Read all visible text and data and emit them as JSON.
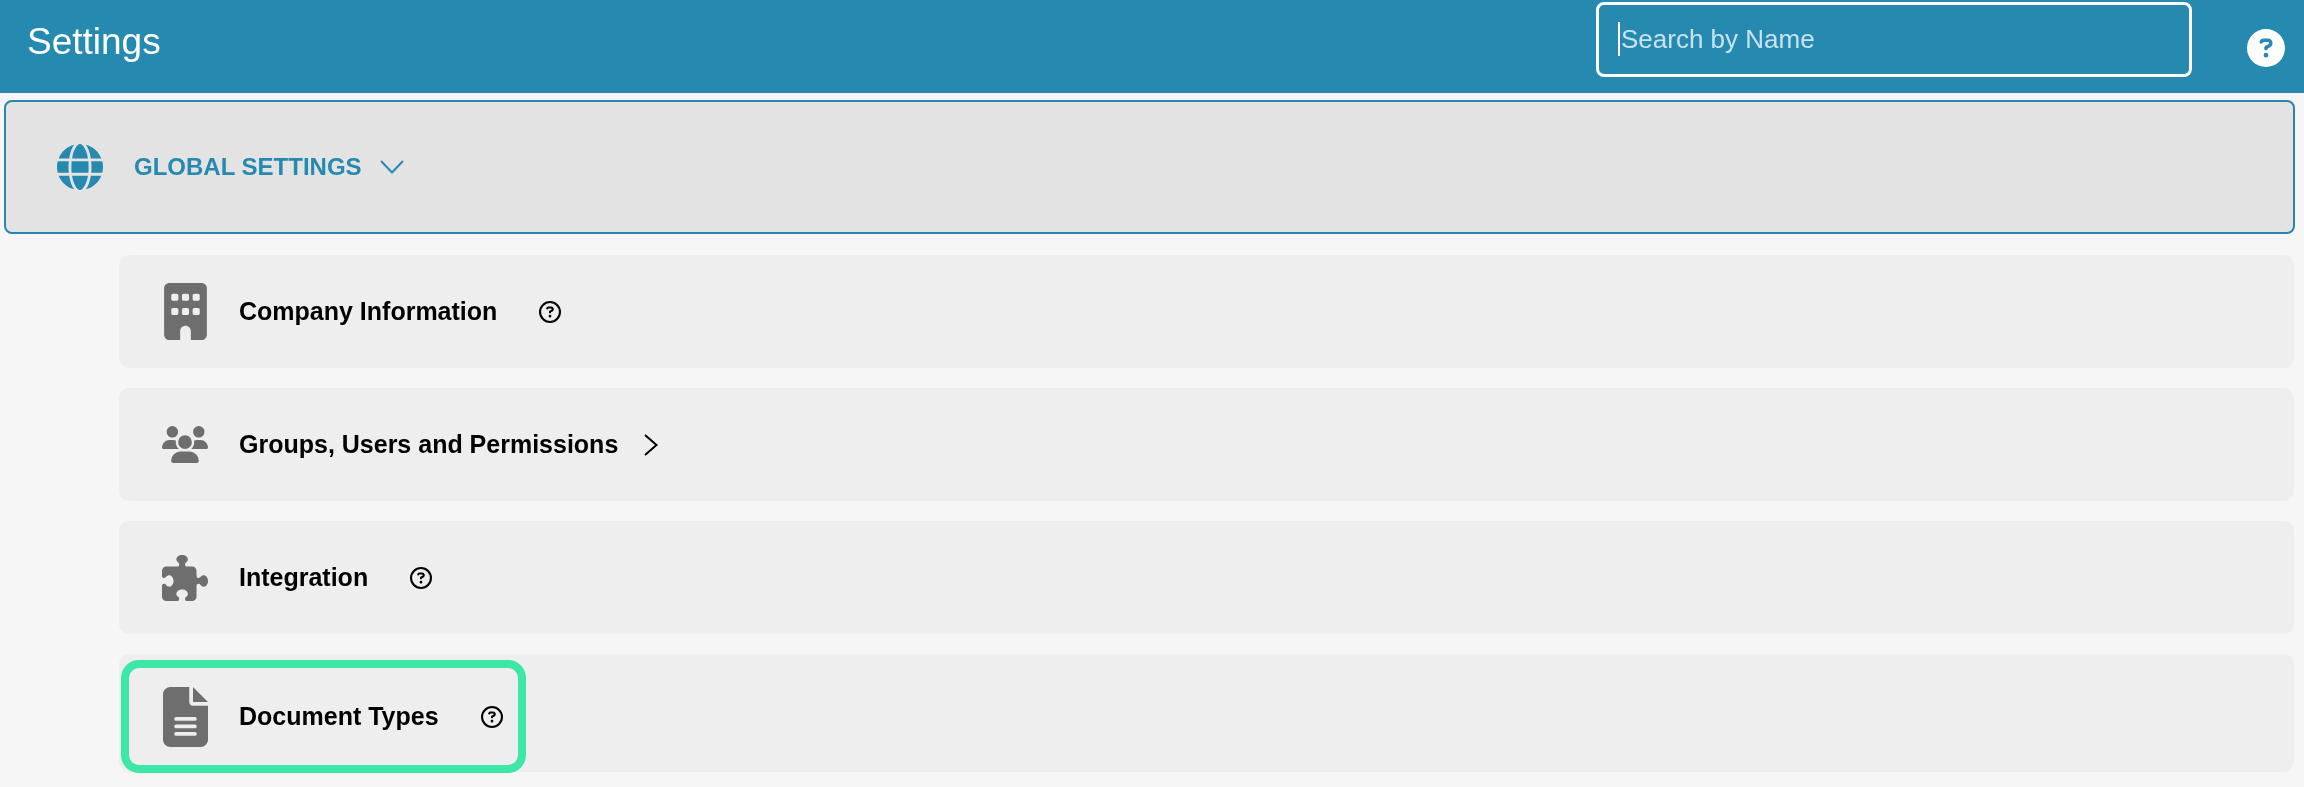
{
  "header": {
    "title": "Settings",
    "search": {
      "placeholder": "Search by Name",
      "focused": true
    }
  },
  "section": {
    "title": "GLOBAL SETTINGS",
    "expanded": true,
    "items": [
      {
        "label": "Company Information",
        "kind": "help",
        "highlighted": false
      },
      {
        "label": "Groups, Users and Permissions",
        "kind": "group",
        "expanded": false,
        "highlighted": false
      },
      {
        "label": "Integration",
        "kind": "help",
        "highlighted": false
      },
      {
        "label": "Document Types",
        "kind": "help",
        "highlighted": true
      }
    ]
  }
}
